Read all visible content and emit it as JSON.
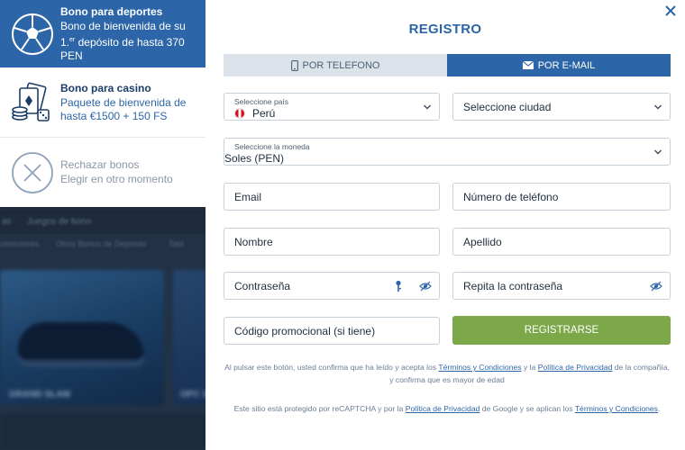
{
  "background": {
    "nav": [
      "as",
      "Juegos de bono"
    ],
    "subnav": [
      "omociones",
      "Otros Bonos de Depósito",
      "Tabl"
    ],
    "cards": [
      "GRAND SLAM",
      "OPC 3"
    ]
  },
  "bonus_panel": {
    "sports": {
      "title": "Bono para deportes",
      "desc_pre": "Bono de bienvenida de su 1.",
      "desc_sup": "er",
      "desc_post": "depósito de hasta 370 PEN",
      "icon": "soccer-ball-icon"
    },
    "casino": {
      "title": "Bono para casino",
      "desc": "Paquete de bienvenida de hasta €1500 + 150 FS",
      "icon": "casino-chips-cards-icon"
    },
    "reject": {
      "title": "Rechazar bonos",
      "desc": "Elegir en otro momento",
      "icon": "reject-x-icon"
    }
  },
  "modal": {
    "title": "REGISTRO",
    "tabs": {
      "phone": "POR TELEFONO",
      "email": "POR E-MAIL"
    },
    "country": {
      "label": "Seleccione país",
      "value": "Perú"
    },
    "city": {
      "value": "Seleccione ciudad"
    },
    "currency": {
      "label": "Seleccione la moneda",
      "value": "Soles (PEN)"
    },
    "email": {
      "placeholder": "Email"
    },
    "phone": {
      "placeholder": "Número de teléfono"
    },
    "first_name": {
      "placeholder": "Nombre"
    },
    "last_name": {
      "placeholder": "Apellido"
    },
    "password": {
      "placeholder": "Contraseña"
    },
    "password_repeat": {
      "placeholder": "Repita la contraseña"
    },
    "promo": {
      "placeholder": "Código promocional (si tiene)"
    },
    "register_button": "REGISTRARSE",
    "legal1": {
      "pre": "Al pulsar este botón, usted confirma que ha leído y acepta los ",
      "link1": "Términos y Condiciones",
      "mid": " y la ",
      "link2": "Política de Privacidad",
      "post": " de la compañía, y confirma que es mayor de edad"
    },
    "legal2": {
      "pre": "Este sitio está protegido por reCAPTCHA y por la ",
      "link1": "Política de Privacidad",
      "mid": " de Google y se aplican los ",
      "link2": "Términos y Condiciones",
      "post": "."
    }
  },
  "colors": {
    "primary": "#2d66a8",
    "register": "#7ca84a",
    "tab_inactive": "#dbe2ea"
  }
}
